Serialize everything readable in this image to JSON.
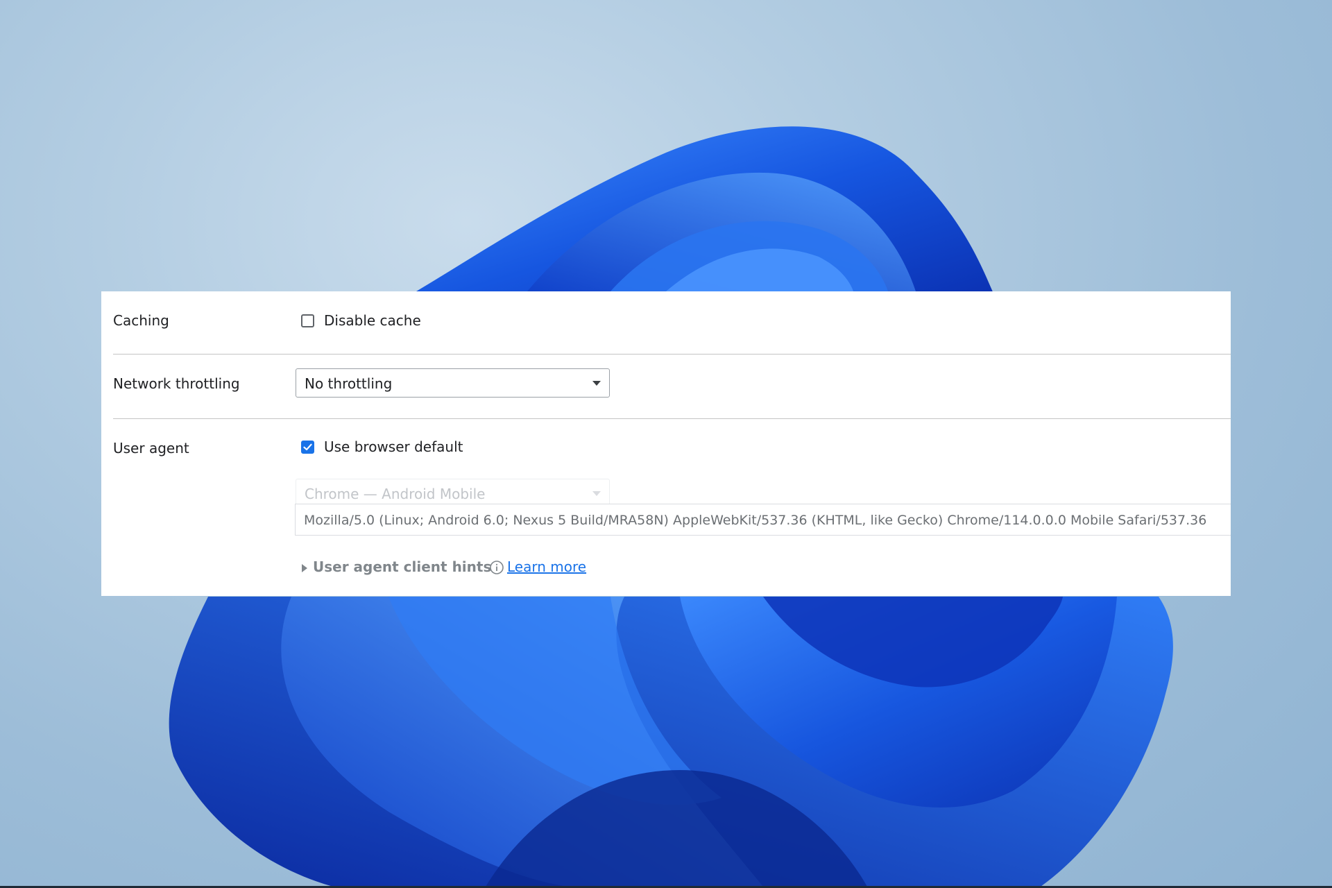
{
  "settings": {
    "caching": {
      "label": "Caching",
      "checkbox_label": "Disable cache",
      "checked": false
    },
    "network_throttling": {
      "label": "Network throttling",
      "selected": "No throttling"
    },
    "user_agent": {
      "label": "User agent",
      "use_default_label": "Use browser default",
      "use_default_checked": true,
      "preset_selected": "Chrome — Android Mobile",
      "ua_string": "Mozilla/5.0 (Linux; Android 6.0; Nexus 5 Build/MRA58N) AppleWebKit/537.36 (KHTML, like Gecko) Chrome/114.0.0.0 Mobile Safari/537.36",
      "client_hints_label": "User agent client hints",
      "learn_more": "Learn more"
    }
  },
  "colors": {
    "accent": "#1a73e8",
    "wallpaper_bloom": "#1b5fe0"
  },
  "icons": [
    "checkbox-icon",
    "dropdown-caret-icon",
    "disclosure-triangle-icon",
    "info-icon"
  ]
}
